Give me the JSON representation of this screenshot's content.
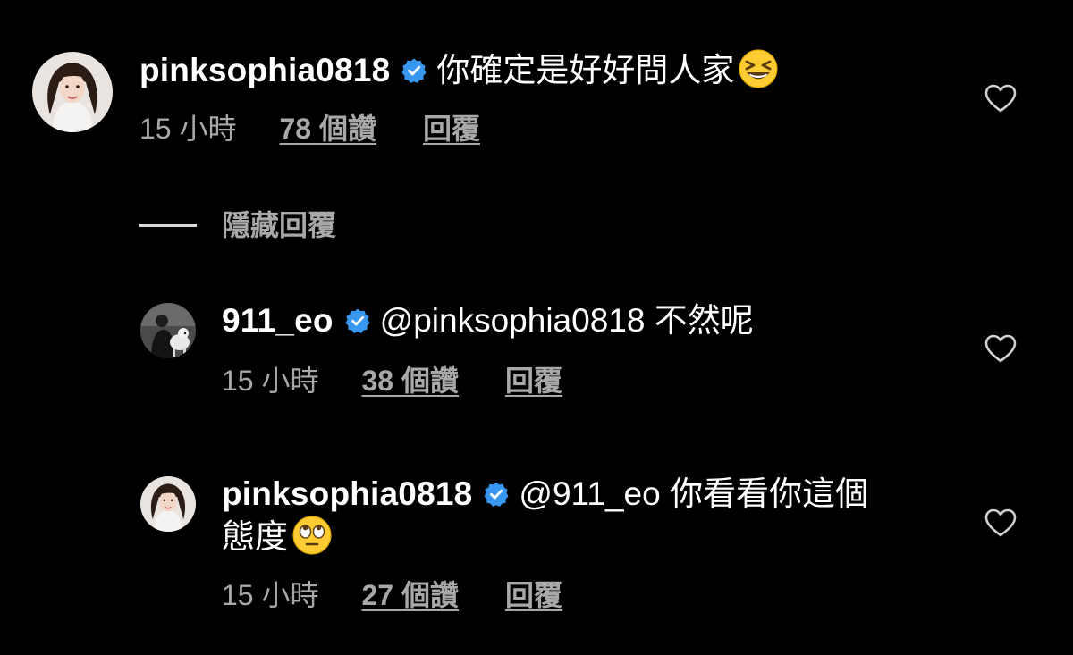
{
  "colors": {
    "background": "#000000",
    "primary_text": "#ffffff",
    "secondary_text": "#a8a8a8",
    "verified_blue": "#3897f0"
  },
  "comments": [
    {
      "username": "pinksophia0818",
      "verified": true,
      "text": "你確定是好好問人家",
      "text_line2": "",
      "emoji": "grinning-squinting-face-emoji",
      "time": "15 小時",
      "likes": "78 個讚",
      "reply": "回覆",
      "avatar": "woman-portrait-avatar",
      "like_icon": "heart-outline-icon"
    },
    {
      "username": "911_eo",
      "verified": true,
      "text": "@pinksophia0818 不然呢",
      "text_line2": "",
      "emoji": "",
      "time": "15 小時",
      "likes": "38 個讚",
      "reply": "回覆",
      "avatar": "man-with-dog-avatar",
      "like_icon": "heart-outline-icon"
    },
    {
      "username": "pinksophia0818",
      "verified": true,
      "text": "@911_eo 你看看你這個",
      "text_line2": "態度",
      "emoji": "face-with-rolling-eyes-emoji",
      "time": "15 小時",
      "likes": "27 個讚",
      "reply": "回覆",
      "avatar": "woman-portrait-avatar",
      "like_icon": "heart-outline-icon"
    }
  ],
  "hide_replies_label": "隱藏回覆"
}
